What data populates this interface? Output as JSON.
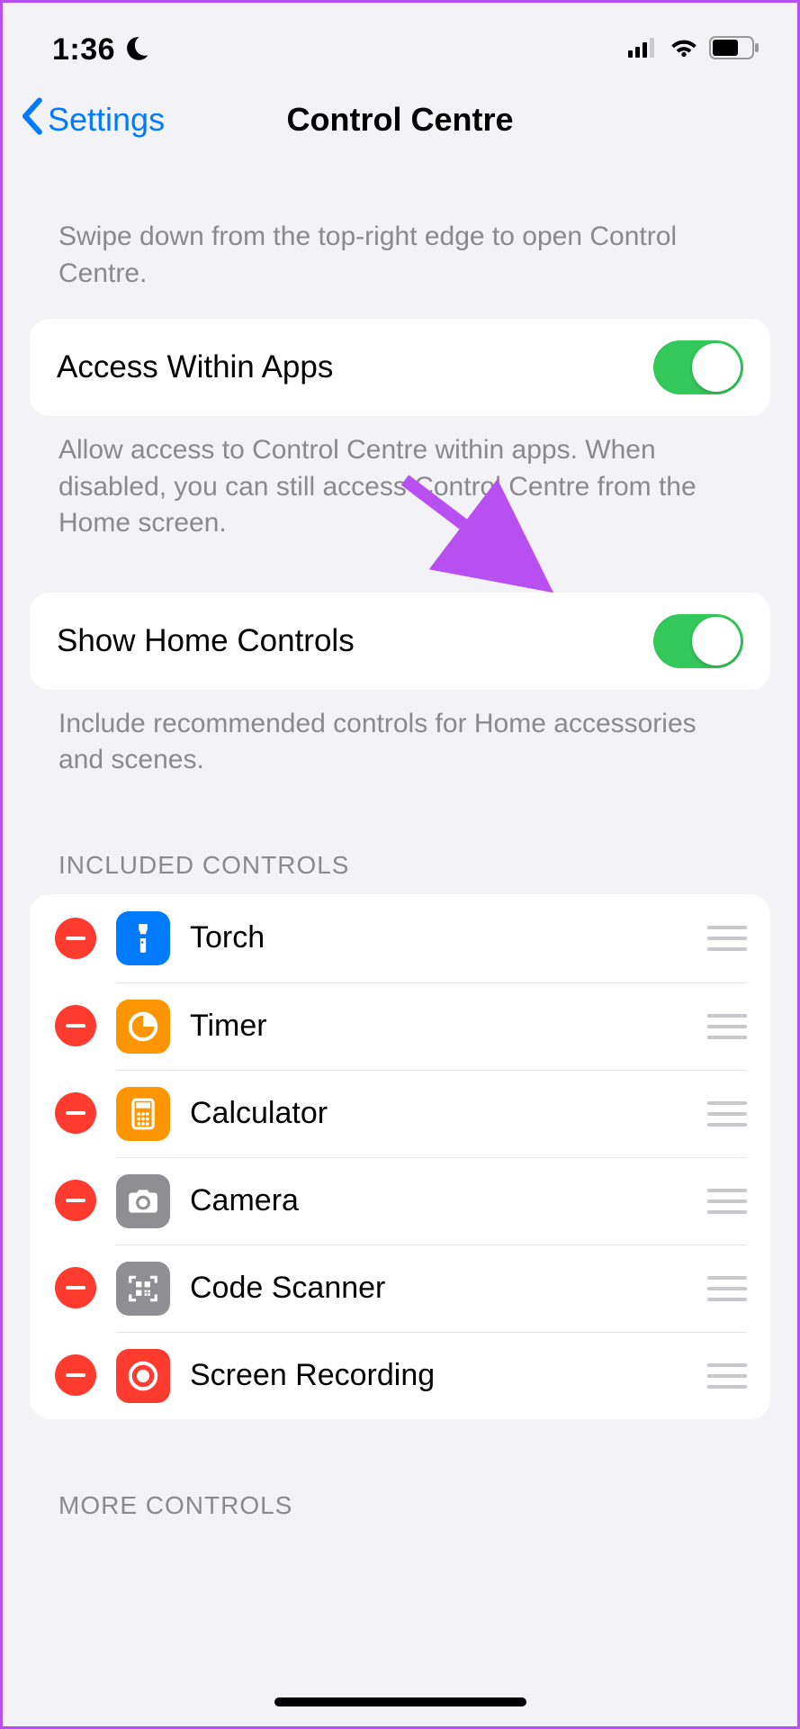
{
  "status": {
    "time": "1:36"
  },
  "nav": {
    "back": "Settings",
    "title": "Control Centre"
  },
  "intro": "Swipe down from the top-right edge to open Control Centre.",
  "toggles": {
    "access": {
      "label": "Access Within Apps",
      "on": true,
      "footer": "Allow access to Control Centre within apps. When disabled, you can still access Control Centre from the Home screen."
    },
    "home": {
      "label": "Show Home Controls",
      "on": true,
      "footer": "Include recommended controls for Home accessories and scenes."
    }
  },
  "sections": {
    "included_header": "INCLUDED CONTROLS",
    "more_header": "MORE CONTROLS"
  },
  "included": [
    {
      "label": "Torch",
      "icon": "torch",
      "color": "blue"
    },
    {
      "label": "Timer",
      "icon": "timer",
      "color": "orange"
    },
    {
      "label": "Calculator",
      "icon": "calculator",
      "color": "orange"
    },
    {
      "label": "Camera",
      "icon": "camera",
      "color": "gray"
    },
    {
      "label": "Code Scanner",
      "icon": "qr",
      "color": "gray"
    },
    {
      "label": "Screen Recording",
      "icon": "record",
      "color": "red"
    }
  ]
}
